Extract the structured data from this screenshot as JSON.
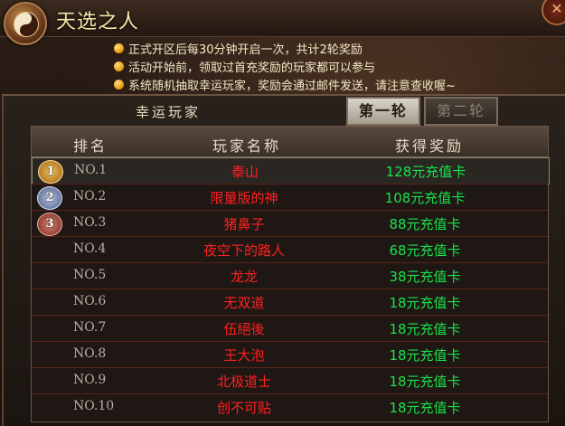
{
  "window": {
    "title": "天选之人"
  },
  "notes": [
    "正式开区后每30分钟开启一次，共计2轮奖励",
    "活动开始前，领取过首充奖励的玩家都可以参与",
    "系统随机抽取幸运玩家，奖励会通过邮件发送，请注意查收喔~"
  ],
  "panel": {
    "label": "幸运玩家"
  },
  "tabs": [
    {
      "label": "第一轮",
      "active": true
    },
    {
      "label": "第二轮",
      "active": false
    }
  ],
  "table": {
    "headers": [
      "排名",
      "玩家名称",
      "获得奖励"
    ],
    "rows": [
      {
        "rank": "NO.1",
        "player": "泰山",
        "reward": "128元充值卡",
        "medal": "1"
      },
      {
        "rank": "NO.2",
        "player": "限量版的神",
        "reward": "108元充值卡",
        "medal": "2"
      },
      {
        "rank": "NO.3",
        "player": "猪鼻子",
        "reward": "88元充值卡",
        "medal": "3"
      },
      {
        "rank": "NO.4",
        "player": "夜空下的路人",
        "reward": "68元充值卡"
      },
      {
        "rank": "NO.5",
        "player": "龙龙",
        "reward": "38元充值卡"
      },
      {
        "rank": "NO.6",
        "player": "无双道",
        "reward": "18元充值卡"
      },
      {
        "rank": "NO.7",
        "player": "伍絕後",
        "reward": "18元充值卡"
      },
      {
        "rank": "NO.8",
        "player": "王大泡",
        "reward": "18元充值卡"
      },
      {
        "rank": "NO.9",
        "player": "北极道士",
        "reward": "18元充值卡"
      },
      {
        "rank": "NO.10",
        "player": "创不可贴",
        "reward": "18元充值卡"
      }
    ]
  },
  "colors": {
    "player_name": "#ff2020",
    "reward": "#19e34a",
    "title": "#f5e7a8"
  },
  "icons": {
    "emblem": "yin-yang-emblem-icon",
    "close": "close-icon",
    "bullet": "bullet-dot-icon"
  }
}
